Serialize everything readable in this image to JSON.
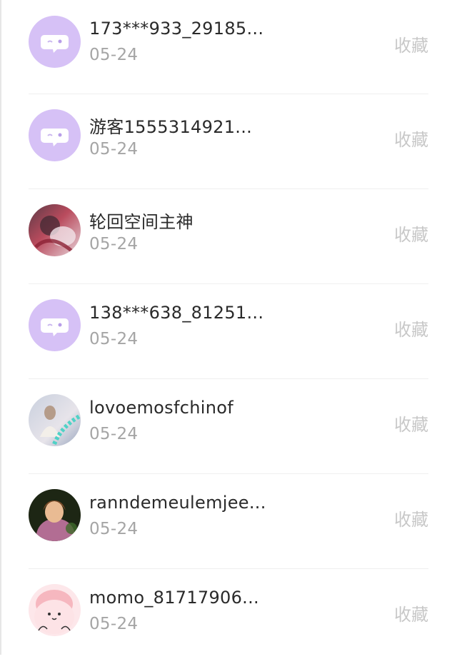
{
  "colors": {
    "default_avatar_bg": "#d6c1f6",
    "name_text": "#2a2a2a",
    "date_text": "#a5a5a5",
    "collect_text": "#c8c8c8"
  },
  "items": [
    {
      "name": "173***933_29185...",
      "date": "05-24",
      "action": "收藏",
      "avatar": "chat-bubble-icon"
    },
    {
      "name": "游客1555314921...",
      "date": "05-24",
      "action": "收藏",
      "avatar": "chat-bubble-icon"
    },
    {
      "name": "轮回空间主神",
      "date": "05-24",
      "action": "收藏",
      "avatar": "photo"
    },
    {
      "name": "138***638_81251...",
      "date": "05-24",
      "action": "收藏",
      "avatar": "chat-bubble-icon"
    },
    {
      "name": "lovoemosfchinof",
      "date": "05-24",
      "action": "收藏",
      "avatar": "photo"
    },
    {
      "name": "ranndemeulemjee...",
      "date": "05-24",
      "action": "收藏",
      "avatar": "photo"
    },
    {
      "name": "momo_81717906...",
      "date": "05-24",
      "action": "收藏",
      "avatar": "cartoon"
    }
  ]
}
